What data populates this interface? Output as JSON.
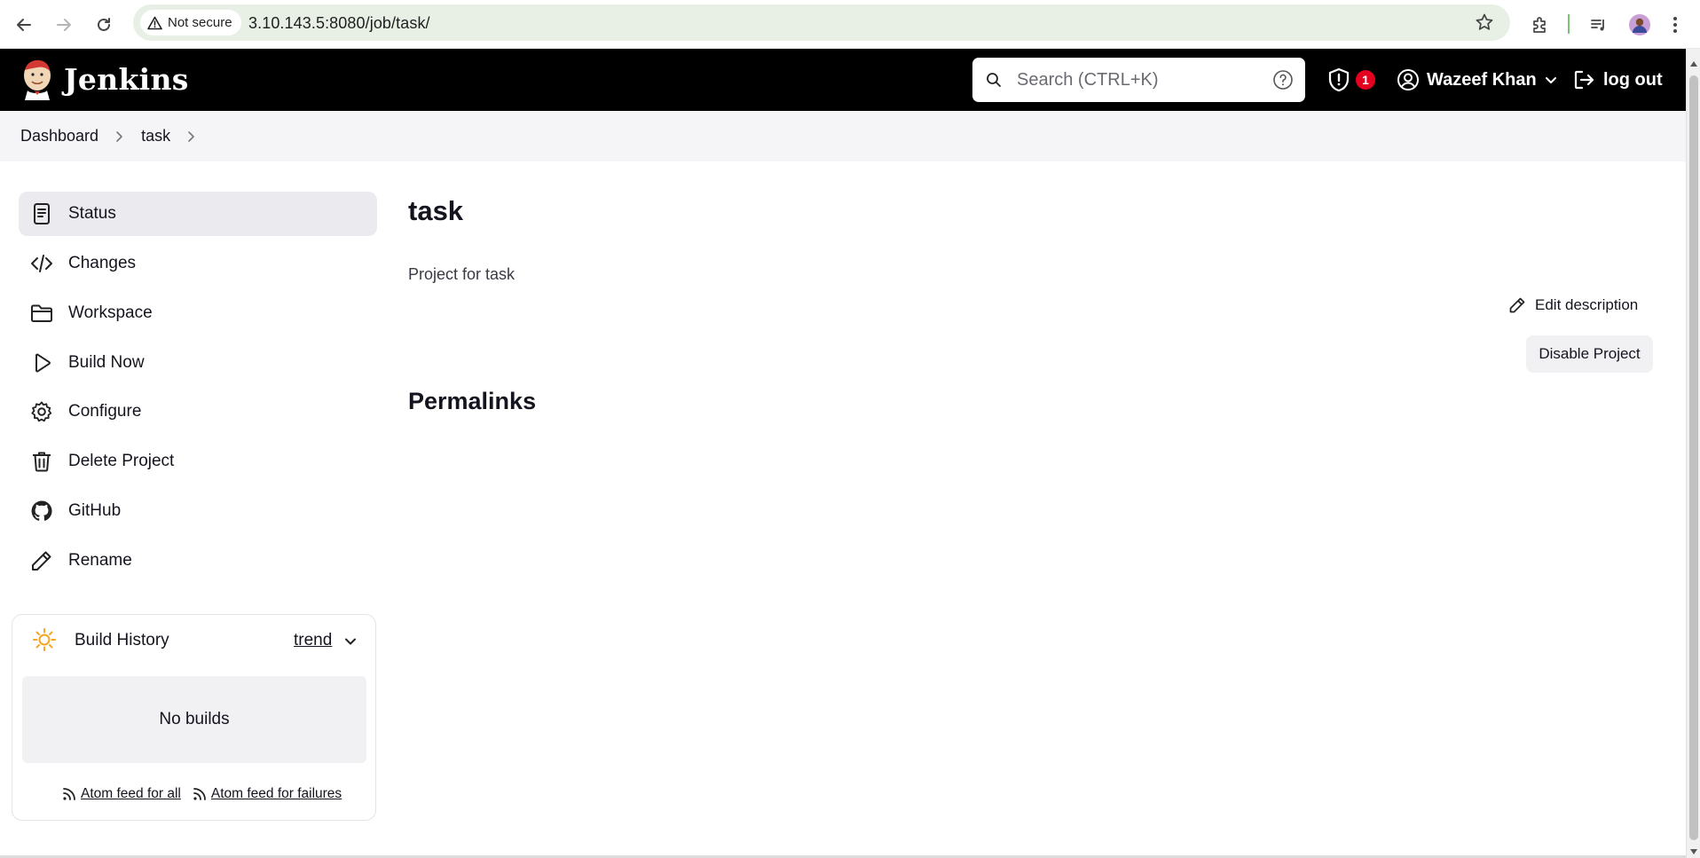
{
  "browser": {
    "security_label": "Not secure",
    "url": "3.10.143.5:8080/job/task/"
  },
  "header": {
    "brand": "Jenkins",
    "search_placeholder": "Search (CTRL+K)",
    "security_count": "1",
    "user_name": "Wazeef Khan",
    "logout_label": "log out"
  },
  "breadcrumb": {
    "items": [
      "Dashboard",
      "task"
    ]
  },
  "sidebar": {
    "items": [
      {
        "label": "Status",
        "icon": "status-icon"
      },
      {
        "label": "Changes",
        "icon": "code-icon"
      },
      {
        "label": "Workspace",
        "icon": "folder-icon"
      },
      {
        "label": "Build Now",
        "icon": "play-icon"
      },
      {
        "label": "Configure",
        "icon": "gear-icon"
      },
      {
        "label": "Delete Project",
        "icon": "trash-icon"
      },
      {
        "label": "GitHub",
        "icon": "github-icon"
      },
      {
        "label": "Rename",
        "icon": "pencil-icon"
      }
    ]
  },
  "build_history": {
    "title": "Build History",
    "trend_label": "trend",
    "empty_text": "No builds",
    "feed_all": "Atom feed for all",
    "feed_failures": "Atom feed for failures"
  },
  "main": {
    "title": "task",
    "description": "Project for task",
    "edit_description_label": "Edit description",
    "disable_button_label": "Disable Project",
    "permalinks_heading": "Permalinks"
  },
  "colors": {
    "header_bg": "#000000",
    "badge": "#e6001f",
    "omnibox_bg": "#e8f0e6",
    "active_item_bg": "#ebebef",
    "sun": "#f5a623"
  }
}
